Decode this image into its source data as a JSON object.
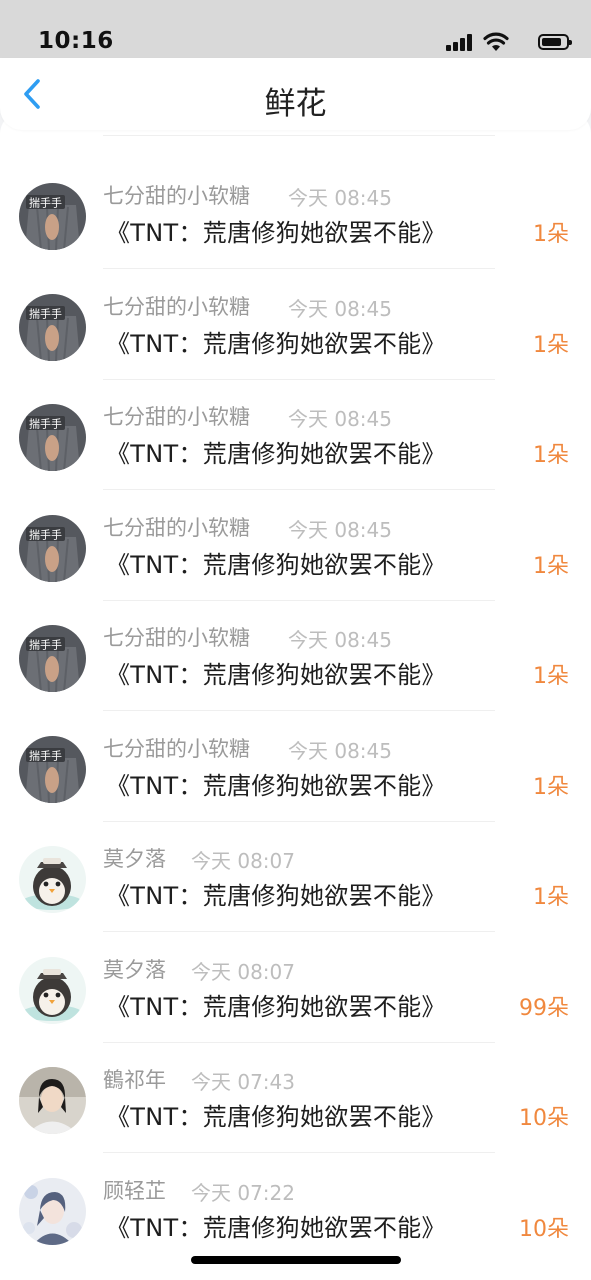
{
  "status_bar": {
    "time": "10:16"
  },
  "header": {
    "title": "鲜花",
    "back_icon": "chevron-left-icon"
  },
  "colors": {
    "accent": "#2e9df2",
    "count": "#f0883e",
    "name": "#9a9a9a",
    "time": "#bdbdbd"
  },
  "list": {
    "items": [
      {
        "name": "七分甜的小软糖",
        "time": "今天 08:45",
        "message": "《TNT：荒唐修狗她欲罢不能》",
        "count": "1朵",
        "avatar_text": "揣手手",
        "avatar": "hands-avatar"
      },
      {
        "name": "七分甜的小软糖",
        "time": "今天 08:45",
        "message": "《TNT：荒唐修狗她欲罢不能》",
        "count": "1朵",
        "avatar_text": "揣手手",
        "avatar": "hands-avatar"
      },
      {
        "name": "七分甜的小软糖",
        "time": "今天 08:45",
        "message": "《TNT：荒唐修狗她欲罢不能》",
        "count": "1朵",
        "avatar_text": "揣手手",
        "avatar": "hands-avatar"
      },
      {
        "name": "七分甜的小软糖",
        "time": "今天 08:45",
        "message": "《TNT：荒唐修狗她欲罢不能》",
        "count": "1朵",
        "avatar_text": "揣手手",
        "avatar": "hands-avatar"
      },
      {
        "name": "七分甜的小软糖",
        "time": "今天 08:45",
        "message": "《TNT：荒唐修狗她欲罢不能》",
        "count": "1朵",
        "avatar_text": "揣手手",
        "avatar": "hands-avatar"
      },
      {
        "name": "七分甜的小软糖",
        "time": "今天 08:45",
        "message": "《TNT：荒唐修狗她欲罢不能》",
        "count": "1朵",
        "avatar_text": "揣手手",
        "avatar": "hands-avatar"
      },
      {
        "name": "莫夕落",
        "time": "今天 08:07",
        "message": "《TNT：荒唐修狗她欲罢不能》",
        "count": "1朵",
        "avatar": "penguin-avatar"
      },
      {
        "name": "莫夕落",
        "time": "今天 08:07",
        "message": "《TNT：荒唐修狗她欲罢不能》",
        "count": "99朵",
        "avatar": "penguin-avatar"
      },
      {
        "name": "鶴祁年",
        "time": "今天 07:43",
        "message": "《TNT：荒唐修狗她欲罢不能》",
        "count": "10朵",
        "avatar": "portrait-avatar"
      },
      {
        "name": "顾轻芷",
        "time": "今天 07:22",
        "message": "《TNT：荒唐修狗她欲罢不能》",
        "count": "10朵",
        "avatar": "anime-avatar"
      }
    ]
  }
}
